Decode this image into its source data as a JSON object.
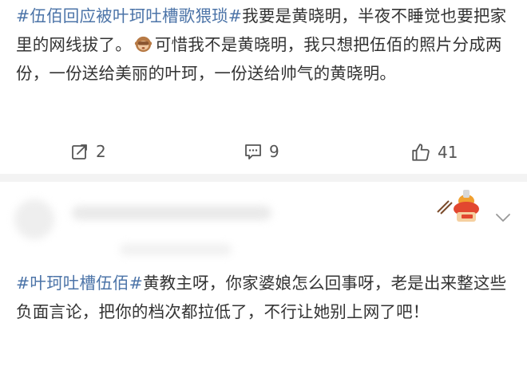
{
  "post": {
    "hashtag": "#伍佰回应被叶珂吐槽歌猥琐#",
    "text_part1": "我要是黄晓明，半夜不睡觉也要把家里的网线拔了。",
    "text_part2": "可惜我不是黄晓明，我只想把伍佰的照片分成两份，一份送给美丽的叶珂，一份送给帅气的黄晓明。",
    "emoji": "see-no-evil-monkey"
  },
  "actions": {
    "repost_count": "2",
    "comment_count": "9",
    "like_count": "41",
    "icons": [
      "repost-icon",
      "comment-icon",
      "like-icon"
    ]
  },
  "comment": {
    "hashtag": "#叶珂吐槽伍佰#",
    "text": "黄教主呀，你家婆娘怎么回事呀，老是出来整这些负面言论，把你的档次都拉低了，不行让她别上网了吧！",
    "icons": [
      "hotpot-sticker-icon",
      "chevron-down-icon"
    ]
  },
  "colors": {
    "link": "#4C74A8",
    "text": "#333333",
    "separator": "#f3f3f3"
  }
}
